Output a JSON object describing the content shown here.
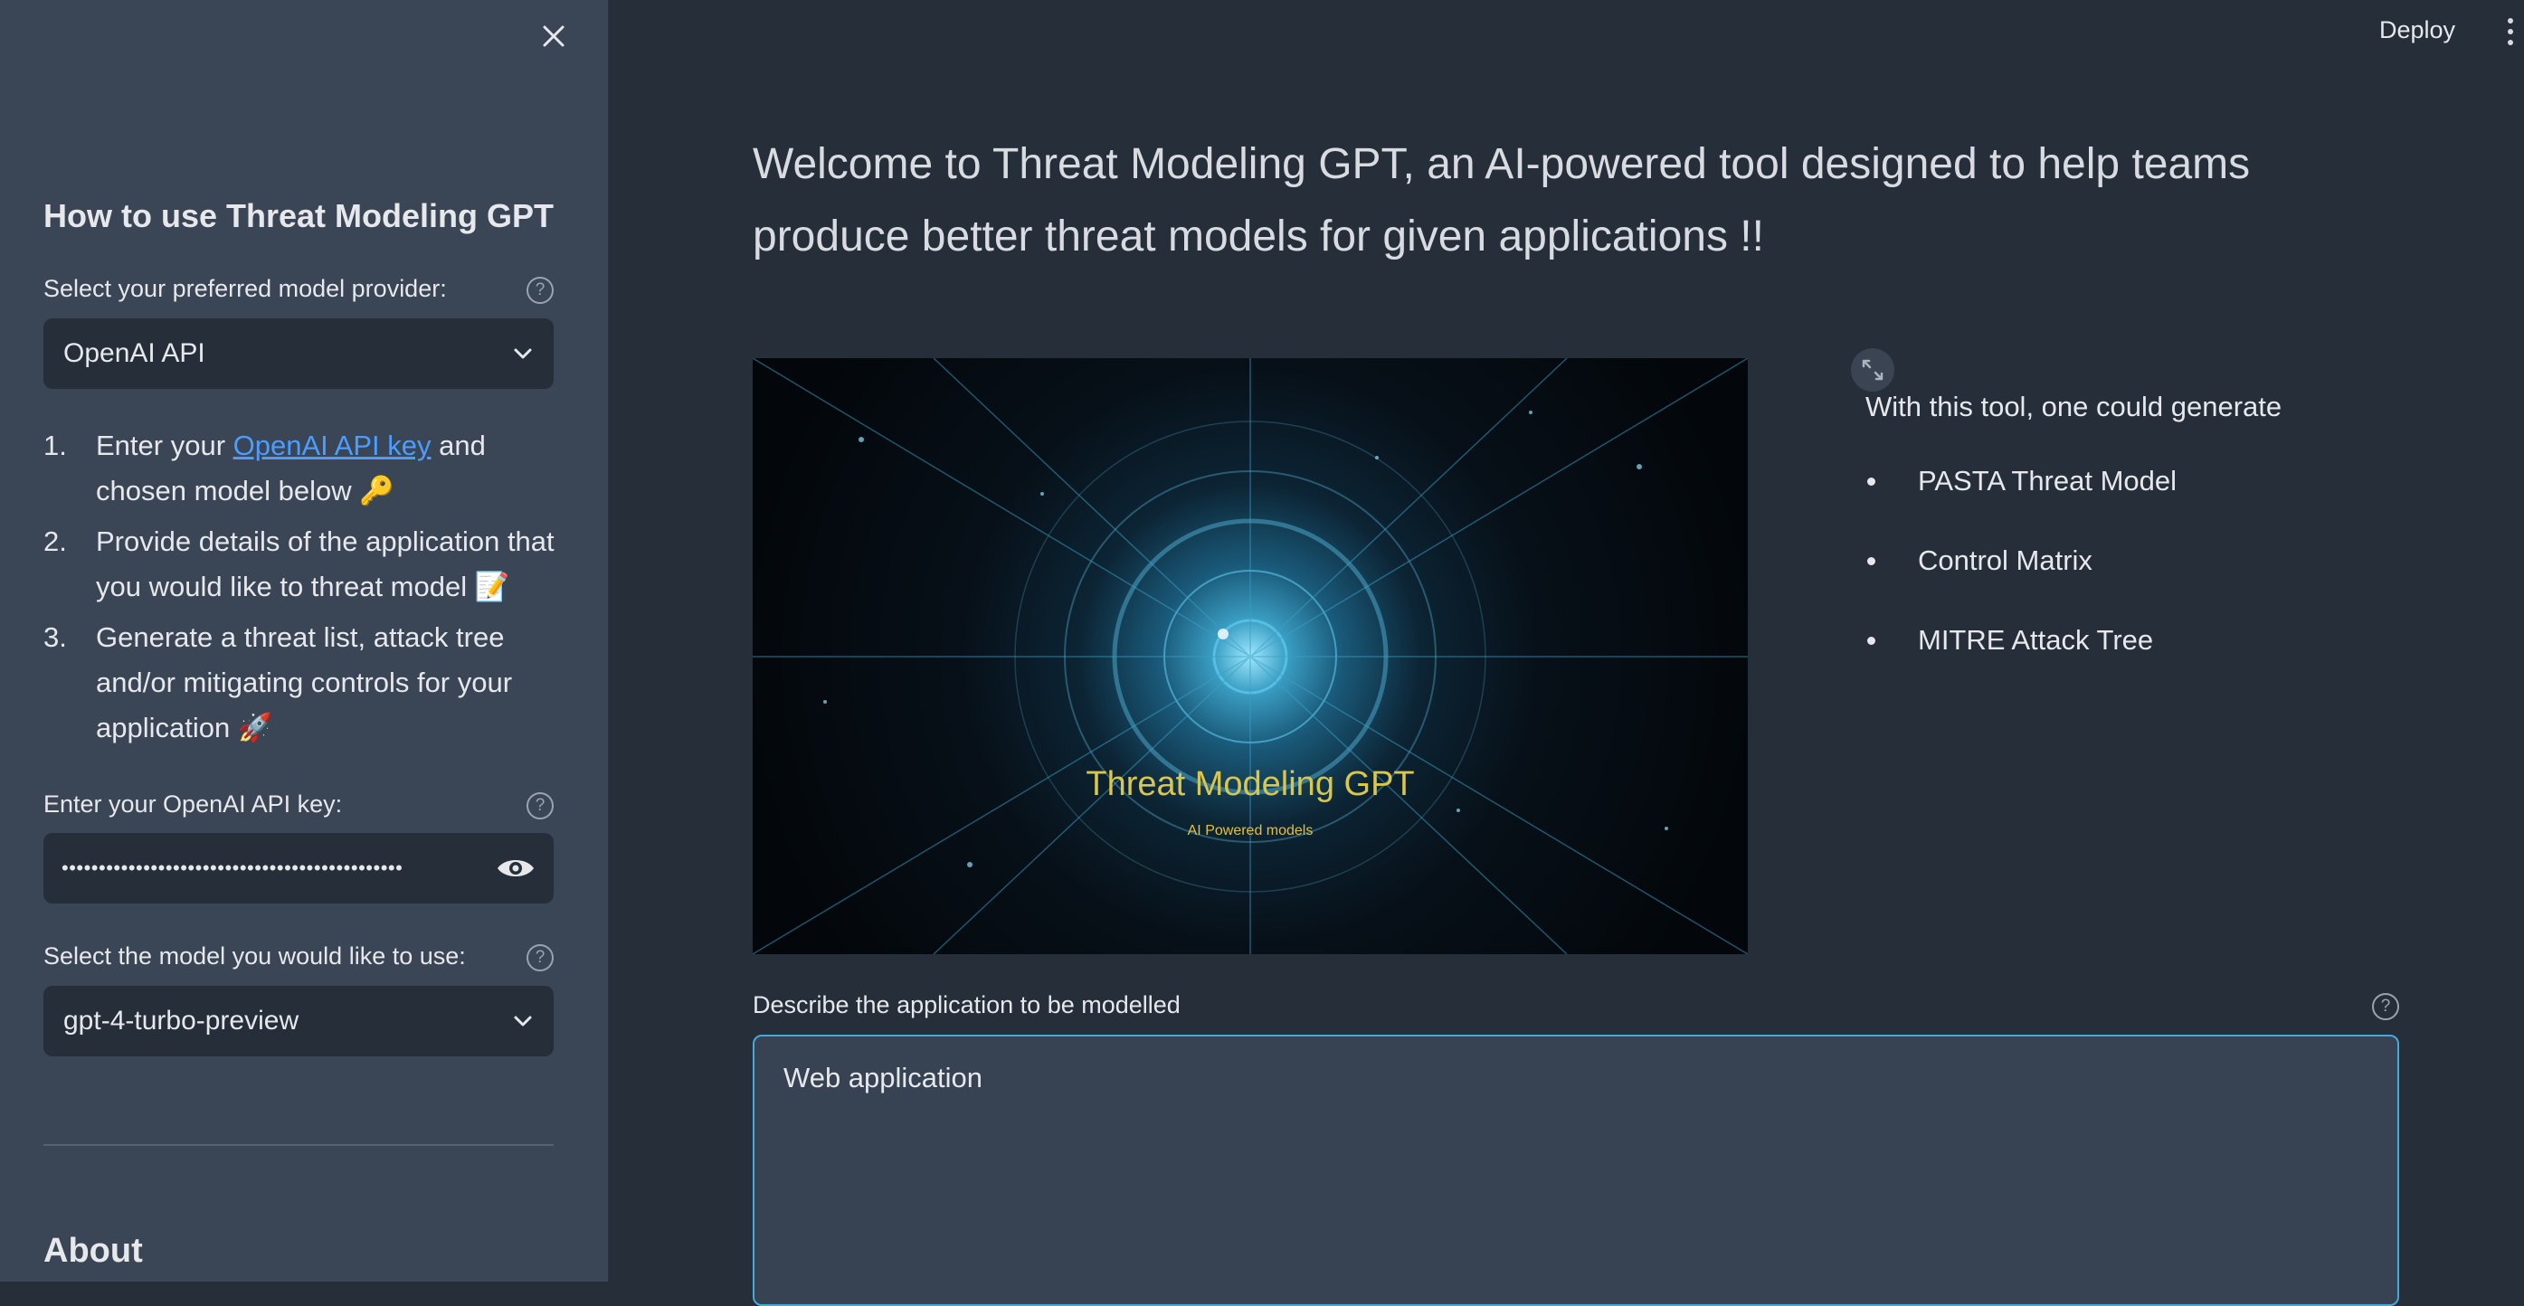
{
  "sidebar": {
    "heading": "How to use Threat Modeling GPT",
    "provider_label": "Select your preferred model provider:",
    "provider_value": "OpenAI API",
    "steps": [
      {
        "num": "1.",
        "before": "Enter your ",
        "link": "OpenAI API key",
        "after": " and chosen model below",
        "emoji": "🔑"
      },
      {
        "num": "2.",
        "text": "Provide details of the application that you would like to threat model",
        "emoji": "📝"
      },
      {
        "num": "3.",
        "text": "Generate a threat list, attack tree and/or mitigating controls for your application",
        "emoji": "🚀"
      }
    ],
    "api_key_label": "Enter your OpenAI API key:",
    "api_key_value": "••••••••••••••••••••••••••••••••••••••••••••••",
    "model_label": "Select the model you would like to use:",
    "model_value": "gpt-4-turbo-preview",
    "about_heading": "About"
  },
  "header": {
    "deploy_label": "Deploy"
  },
  "main": {
    "welcome": "Welcome to Threat Modeling GPT, an AI-powered tool designed to help teams produce better threat models for given applications !!",
    "hero_title": "Threat Modeling GPT",
    "hero_subtitle": "AI Powered models",
    "intro": "With this tool, one could generate",
    "features": [
      "PASTA Threat Model",
      "Control Matrix",
      "MITRE Attack Tree"
    ],
    "describe_label": "Describe the application to be modelled",
    "describe_value": "Web application"
  },
  "colors": {
    "sidebar_bg": "#3a4555",
    "main_bg": "#262e39",
    "link": "#4b9dff",
    "focus_border": "#4aa8d8",
    "hero_title": "#d9c64a"
  },
  "icons": [
    "close-icon",
    "help-icon",
    "chevron-down-icon",
    "eye-icon",
    "expand-icon",
    "kebab-menu-icon"
  ]
}
